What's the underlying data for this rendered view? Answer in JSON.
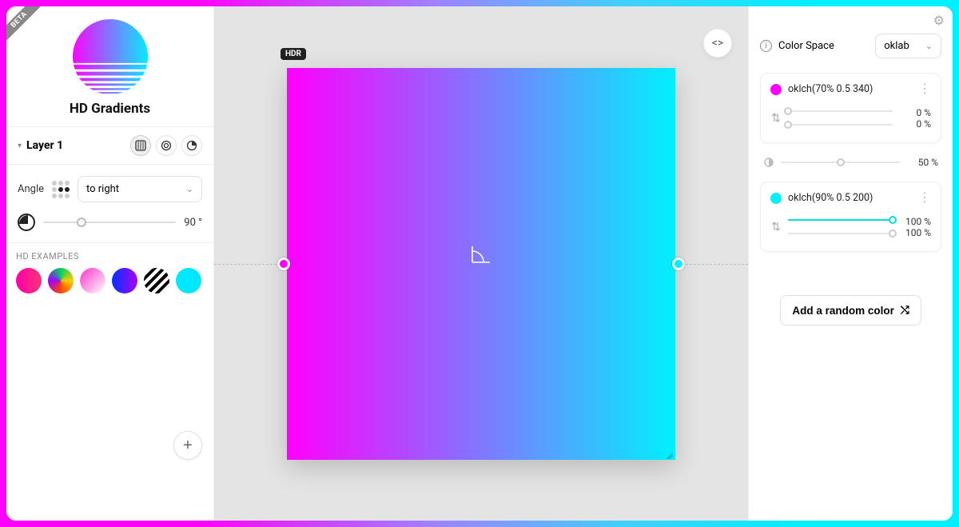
{
  "badge": "BETA",
  "app_title": "HD Gradients",
  "layer": {
    "name": "Layer 1"
  },
  "angle": {
    "label": "Angle",
    "direction": "to right",
    "value": "90 °",
    "slider_pct": 25
  },
  "examples": {
    "title": "HD EXAMPLES"
  },
  "hdr_badge": "HDR",
  "color_space": {
    "label": "Color Space",
    "value": "oklab"
  },
  "stops": [
    {
      "color": "#ff00ff",
      "name": "oklch(70% 0.5 340)",
      "pos1": "0 %",
      "pos2": "0 %",
      "fill_pct": 0
    },
    {
      "color": "#00f0ff",
      "name": "oklch(90% 0.5 200)",
      "pos1": "100 %",
      "pos2": "100 %",
      "fill_pct": 100
    }
  ],
  "midpoint": {
    "value": "50 %",
    "slider_pct": 50
  },
  "random_button": "Add a random color"
}
